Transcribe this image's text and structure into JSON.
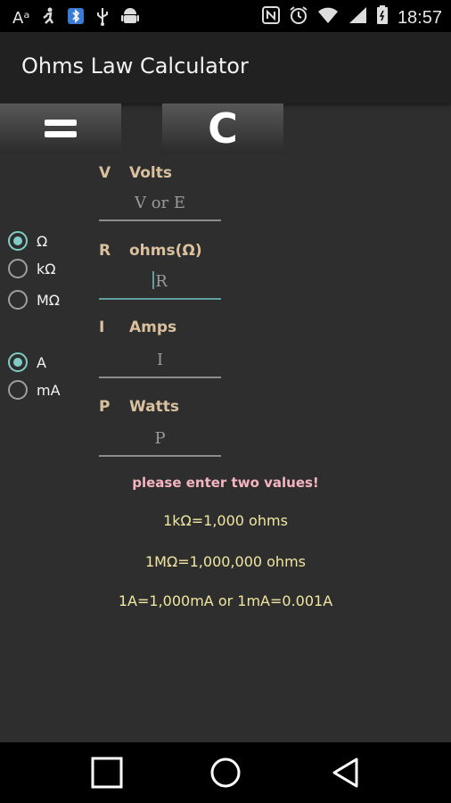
{
  "status_bar": {
    "left_icons": [
      "font-size-icon",
      "running-man-icon",
      "bluetooth-icon",
      "usb-icon",
      "android-icon"
    ],
    "right_icons": [
      "nfc-icon",
      "alarm-icon",
      "wifi-icon",
      "signal-icon",
      "battery-icon"
    ],
    "time": "18:57"
  },
  "app": {
    "title": "Ohms Law Calculator"
  },
  "buttons": {
    "clear_label": "C"
  },
  "fields": {
    "volts": {
      "symbol": "V",
      "label": "Volts",
      "placeholder": "V or E"
    },
    "ohms": {
      "symbol": "R",
      "label": "ohms(Ω)",
      "placeholder": "R"
    },
    "amps": {
      "symbol": "I",
      "label": "Amps",
      "placeholder": "I"
    },
    "watts": {
      "symbol": "P",
      "label": "Watts",
      "placeholder": "P"
    }
  },
  "resistance_units": [
    {
      "label": "Ω",
      "selected": true
    },
    {
      "label": "kΩ",
      "selected": false
    },
    {
      "label": "MΩ",
      "selected": false
    }
  ],
  "current_units": [
    {
      "label": "A",
      "selected": true
    },
    {
      "label": "mA",
      "selected": false
    }
  ],
  "messages": {
    "warning": "please enter two values!",
    "info": [
      "1kΩ=1,000 ohms",
      "1MΩ=1,000,000 ohms",
      "1A=1,000mA or 1mA=0.001A"
    ]
  },
  "colors": {
    "accent": "#80cbc4",
    "label": "#d9c09e",
    "warning": "#f4b5c0",
    "info": "#f0e6a0"
  }
}
